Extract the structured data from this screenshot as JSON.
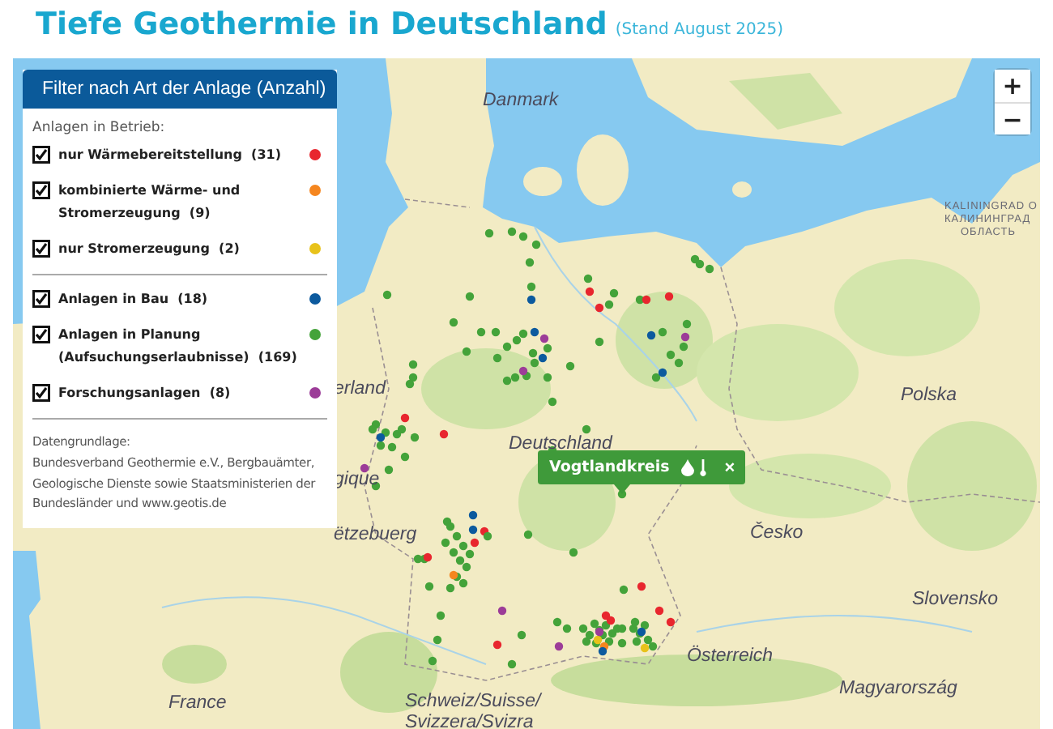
{
  "title": "Tiefe Geothermie in Deutschland",
  "subtitle": "(Stand August 2025)",
  "filter_panel": {
    "title": "Filter nach Art der Anlage (Anzahl)",
    "expanded": true,
    "groups": [
      {
        "heading": "Anlagen in Betrieb:",
        "items": [
          {
            "label": "nur Wärmebereitstellung  (31)",
            "checked": true,
            "color": "#e8262e"
          },
          {
            "label": "kombinierte Wärme- und Stromerzeugung  (9)",
            "checked": true,
            "color": "#f5861f"
          },
          {
            "label": "nur Stromerzeugung  (2)",
            "checked": true,
            "color": "#e8c21a"
          }
        ]
      },
      {
        "items": [
          {
            "label": "Anlagen in Bau  (18)",
            "checked": true,
            "color": "#0c5a9e"
          },
          {
            "label": "Anlagen in Planung (Aufsuchungserlaubnisse)  (169)",
            "checked": true,
            "color": "#44a33a"
          },
          {
            "label": "Forschungsanlagen  (8)",
            "checked": true,
            "color": "#9c3c98"
          }
        ]
      }
    ],
    "source_heading": "Datengrundlage:",
    "source_text": "Bundesverband Geothermie e.V., Bergbauämter, Geologische Dienste sowie Staatsministerien der Bundesländer und www.geotis.de"
  },
  "zoom": {
    "zoom_in": "+",
    "zoom_out": "−"
  },
  "popup": {
    "label": "Vogtlandkreis",
    "close": "×"
  },
  "map_labels": [
    {
      "text": "Danmark",
      "kind": "country"
    },
    {
      "text": "KALININGRAD O",
      "kind": "region"
    },
    {
      "text": "КАЛИНИНГРАД",
      "kind": "region"
    },
    {
      "text": "ОБЛАСТЬ",
      "kind": "region"
    },
    {
      "text": "erland",
      "kind": "country"
    },
    {
      "text": "Polska",
      "kind": "country"
    },
    {
      "text": "Deutschland",
      "kind": "country"
    },
    {
      "text": "gique",
      "kind": "country"
    },
    {
      "text": "ëtzebuerg",
      "kind": "country"
    },
    {
      "text": "Česko",
      "kind": "country"
    },
    {
      "text": "Slovensko",
      "kind": "country"
    },
    {
      "text": "Österreich",
      "kind": "country"
    },
    {
      "text": "Magyarország",
      "kind": "country"
    },
    {
      "text": "France",
      "kind": "country"
    },
    {
      "text": "Schweiz/Suisse/",
      "kind": "country"
    },
    {
      "text": "Svizzera/Svizra",
      "kind": "country"
    }
  ]
}
